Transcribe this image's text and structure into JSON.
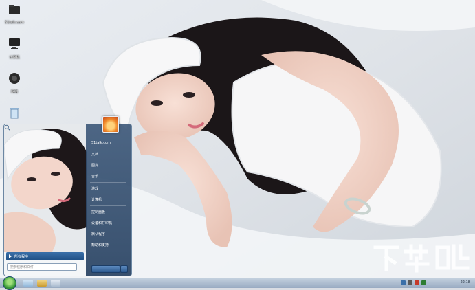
{
  "desktop_icons": [
    {
      "name": "folder-icon",
      "label": "51talk.com"
    },
    {
      "name": "computer-icon",
      "label": "计算机"
    },
    {
      "name": "network-icon",
      "label": "网络"
    },
    {
      "name": "recycle-bin-icon",
      "label": ""
    }
  ],
  "start_menu": {
    "all_programs_label": "所有程序",
    "search_placeholder": "搜索程序和文件",
    "right_items": [
      "51talk.com",
      "文档",
      "图片",
      "音乐",
      "游戏",
      "计算机",
      "控制面板",
      "设备和打印机",
      "默认程序",
      "帮助和支持"
    ]
  },
  "taskbar": {
    "clock_text": "22:18"
  },
  "watermark_text": "下载吧"
}
